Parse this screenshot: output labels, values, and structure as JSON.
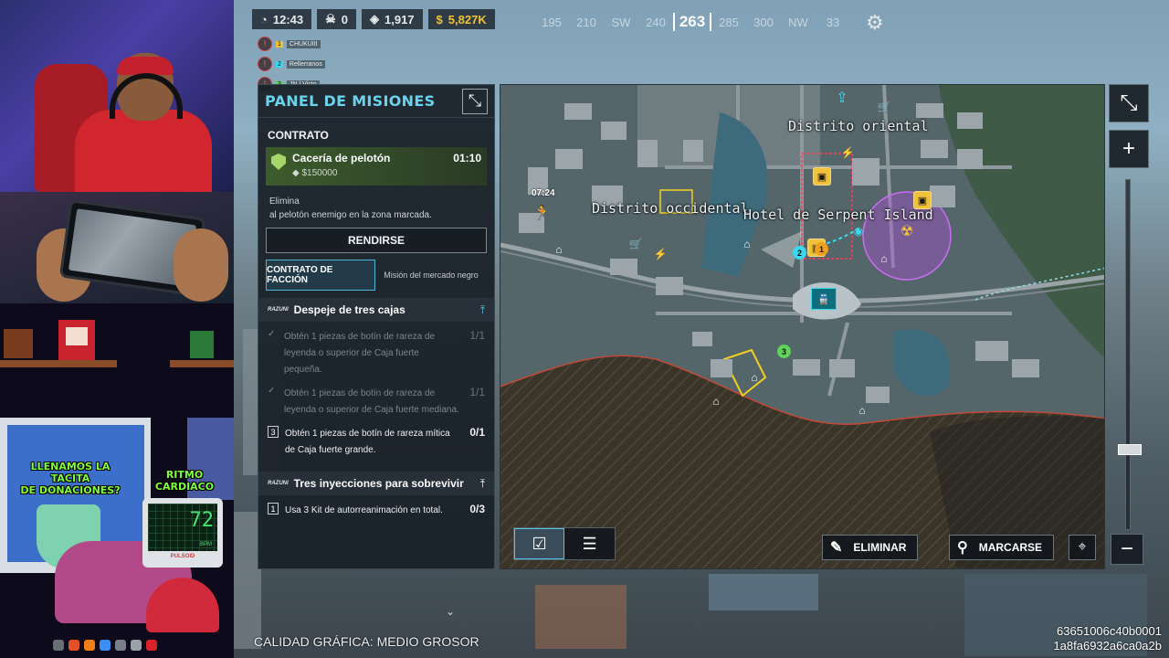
{
  "hud": {
    "time": "12:43",
    "kills": "0",
    "plates": "1,917",
    "cash": "5,827K",
    "compass": [
      "195",
      "210",
      "SW",
      "240",
      "263",
      "285",
      "300",
      "NW",
      "33"
    ],
    "heading": "263"
  },
  "squad": [
    {
      "num": "1",
      "name": "CHUKUIII"
    },
    {
      "num": "2",
      "name": "Rellerranos"
    },
    {
      "num": "3",
      "name": "JN | Victo"
    }
  ],
  "mission_panel": {
    "title": "PANEL DE MISIONES",
    "contract_label": "CONTRATO",
    "contract_name": "Cacería de pelotón",
    "contract_reward": "$150000",
    "contract_timer": "01:10",
    "contract_desc_1": "Elimina",
    "contract_desc_2": "al pelotón enemigo en la zona marcada.",
    "surrender": "RENDIRSE",
    "tab_faction": "CONTRATO DE FACCIÓN",
    "tab_black_market": "Misión del mercado negro",
    "brand": "RAZUNI",
    "mission1": {
      "title": "Despeje de tres cajas",
      "tasks": [
        {
          "mark": "✓",
          "text": "Obtén 1 piezas de botín de rareza de leyenda o superior de Caja fuerte pequeña.",
          "count": "1/1",
          "done": true
        },
        {
          "mark": "✓",
          "text": "Obtén 1 piezas de botín de rareza de leyenda o superior de Caja fuerte mediana.",
          "count": "1/1",
          "done": true
        },
        {
          "mark": "3",
          "text": "Obtén 1 piezas de botín de rareza mítica de Caja fuerte grande.",
          "count": "0/1",
          "done": false
        }
      ]
    },
    "mission2": {
      "title": "Tres inyecciones para sobrevivir",
      "tasks": [
        {
          "mark": "1",
          "text": "Usa 3 Kit de autorreanimación en total.",
          "count": "0/3",
          "done": false
        }
      ]
    }
  },
  "map": {
    "labels": {
      "east": "Distrito oriental",
      "west": "Distrito occidental",
      "hotel": "Hotel de Serpent Island"
    },
    "timer": "07:24",
    "badges": [
      "1",
      "2",
      "3"
    ],
    "actions": {
      "remove": "ELIMINAR",
      "mark": "MARCARSE"
    },
    "zoom_level": 0.78
  },
  "overlay": {
    "donation_line1": "LLENAMOS LA TACITA",
    "donation_line2": "DE DONACIONES?",
    "heart_label": "RITMO CARDIACO",
    "bpm": "72",
    "bpm_unit": "BPM",
    "pulsoid": "PULSOID"
  },
  "footer": {
    "quality": "CALIDAD GRÁFICA: MEDIO GROSOR",
    "session_1": "63651006c40b0001",
    "session_2": "1a8fa6932a6ca0a2b"
  },
  "colors": {
    "accent": "#6ad2ea",
    "cash": "#f1c232",
    "zone": "#b04bdc"
  }
}
